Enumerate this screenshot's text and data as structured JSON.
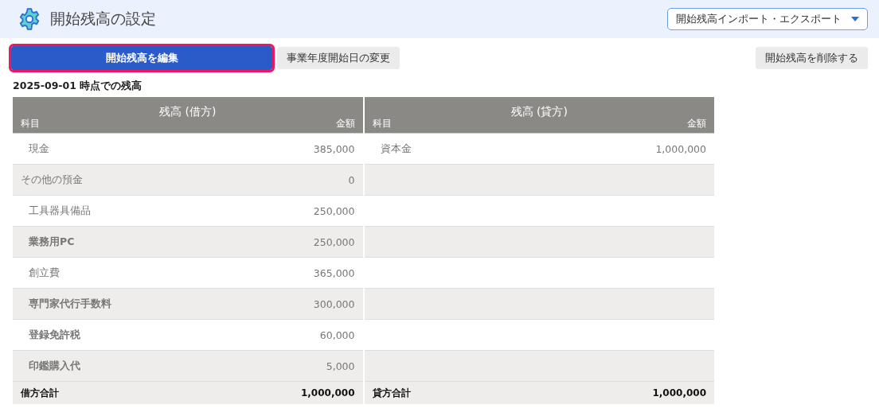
{
  "header": {
    "title": "開始残高の設定",
    "menu": "開始残高インポート・エクスポート"
  },
  "actions": [
    {
      "label": "開始残高を編集",
      "kind": "primary",
      "highlighted": true
    },
    {
      "label": "事業年度開始日の変更",
      "kind": "secondary",
      "highlighted": false
    },
    {
      "label": "開始残高を削除する",
      "kind": "danger",
      "highlighted": false
    }
  ],
  "caption": "2025-09-01 時点での残高",
  "tables": [
    {
      "title": "残高 (借方)",
      "col_account": "科目",
      "col_amount": "金額",
      "rows": [
        {
          "account": "現金",
          "amount": "385,000",
          "indented": true,
          "bold": false
        },
        {
          "account": "その他の預金",
          "amount": "0",
          "indented": false,
          "bold": false
        },
        {
          "account": "工具器具備品",
          "amount": "250,000",
          "indented": true,
          "bold": false
        },
        {
          "account": "業務用PC",
          "amount": "250,000",
          "indented": true,
          "bold": true
        },
        {
          "account": "創立費",
          "amount": "365,000",
          "indented": true,
          "bold": false
        },
        {
          "account": "専門家代行手数料",
          "amount": "300,000",
          "indented": true,
          "bold": true
        },
        {
          "account": "登録免許税",
          "amount": "60,000",
          "indented": true,
          "bold": true
        },
        {
          "account": "印鑑購入代",
          "amount": "5,000",
          "indented": true,
          "bold": true
        }
      ],
      "total_label": "借方合計",
      "total": "1,000,000"
    },
    {
      "title": "残高 (貸方)",
      "col_account": "科目",
      "col_amount": "金額",
      "rows": [
        {
          "account": "資本金",
          "amount": "1,000,000",
          "indented": true,
          "bold": false
        }
      ],
      "total_label": "貸方合計",
      "total": "1,000,000"
    }
  ]
}
